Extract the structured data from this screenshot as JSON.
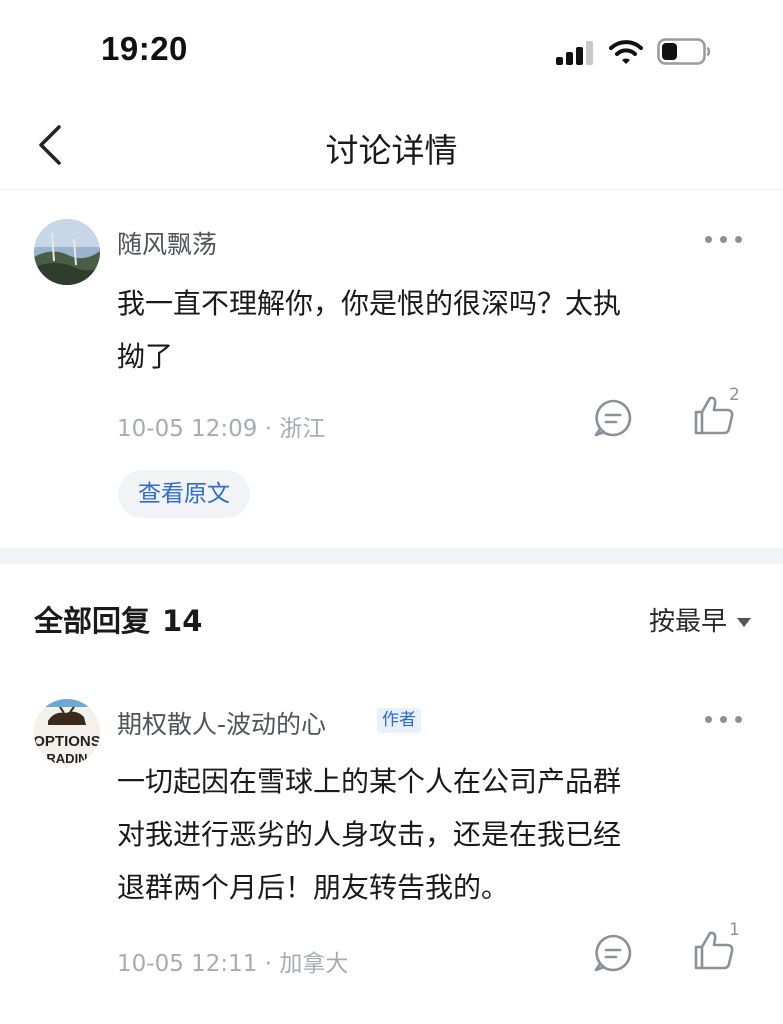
{
  "status_bar": {
    "time": "19:20"
  },
  "nav": {
    "title": "讨论详情"
  },
  "post": {
    "author": "随风飘荡",
    "lines": [
      "我一直不理解你，你是恨的很深吗？太执",
      "拗了"
    ],
    "time": "10-05 12:09",
    "location": "浙江",
    "like_count": "2",
    "view_original_label": "查看原文"
  },
  "replies_header": {
    "label": "全部回复",
    "count": "14",
    "sort_label": "按最早"
  },
  "reply": {
    "author": "期权散人-波动的心",
    "author_tag": "作者",
    "avatar_text_top": "OPTIONS",
    "avatar_text_bottom": "RADIN",
    "lines": [
      "一切起因在雪球上的某个人在公司产品群",
      "对我进行恶劣的人身攻击，还是在我已经",
      "退群两个月后！朋友转告我的。"
    ],
    "time": "10-05 12:11",
    "location": "加拿大",
    "like_count": "1"
  },
  "colors": {
    "accent": "#2e6bd6",
    "muted": "#a8abb3",
    "divider": "#f2f3f6"
  },
  "icons": [
    "back-chevron-icon",
    "signal-icon",
    "wifi-icon",
    "battery-icon",
    "more-icon",
    "comment-icon",
    "thumbs-up-icon"
  ]
}
